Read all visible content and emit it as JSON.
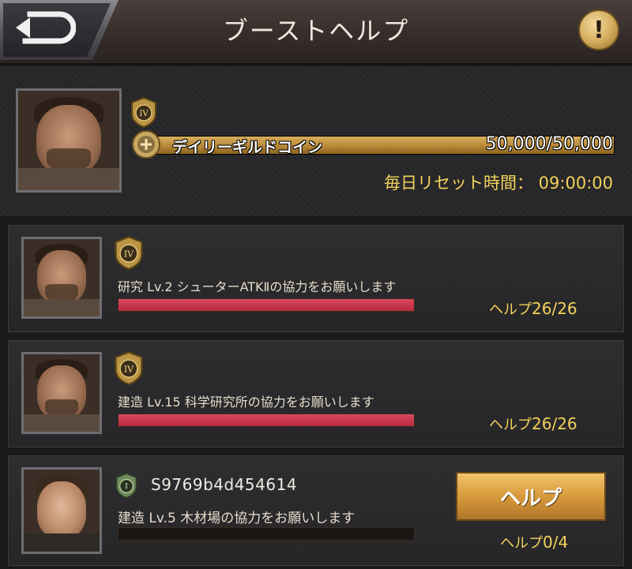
{
  "header": {
    "title": "ブーストヘルプ",
    "info_symbol": "!"
  },
  "guild": {
    "rank": "IV",
    "coin_label": "デイリーギルドコイン",
    "coin_count": "50,000/50,000",
    "coin_progress": 1.0,
    "reset_time": "毎日リセット時間： 09:00:00"
  },
  "requests": [
    {
      "rank": "IV",
      "description": "研究 Lv.2 シューターATKⅡの協力をお願いします",
      "help_label": "ヘルプ",
      "help_count": "26/26",
      "progress": 1.0
    },
    {
      "rank": "IV",
      "description": "建造 Lv.15 科学研究所の協力をお願いします",
      "help_label": "ヘルプ",
      "help_count": "26/26",
      "progress": 1.0
    },
    {
      "rank": "I",
      "player_name": "S9769b4d454614",
      "description": "建造 Lv.5 木材場の協力をお願いします",
      "help_button_label": "ヘルプ",
      "help_label": "ヘルプ",
      "help_count": "0/4",
      "progress": 0.0
    }
  ],
  "colors": {
    "accent_gold": "#f2d25a",
    "progress_red": "#c8324a",
    "coin_bar": "#b88838"
  },
  "icons": {
    "back": "back-arrow-icon",
    "info": "exclamation-icon",
    "rank": "rank-badge-icon",
    "coin": "guild-coin-icon"
  }
}
